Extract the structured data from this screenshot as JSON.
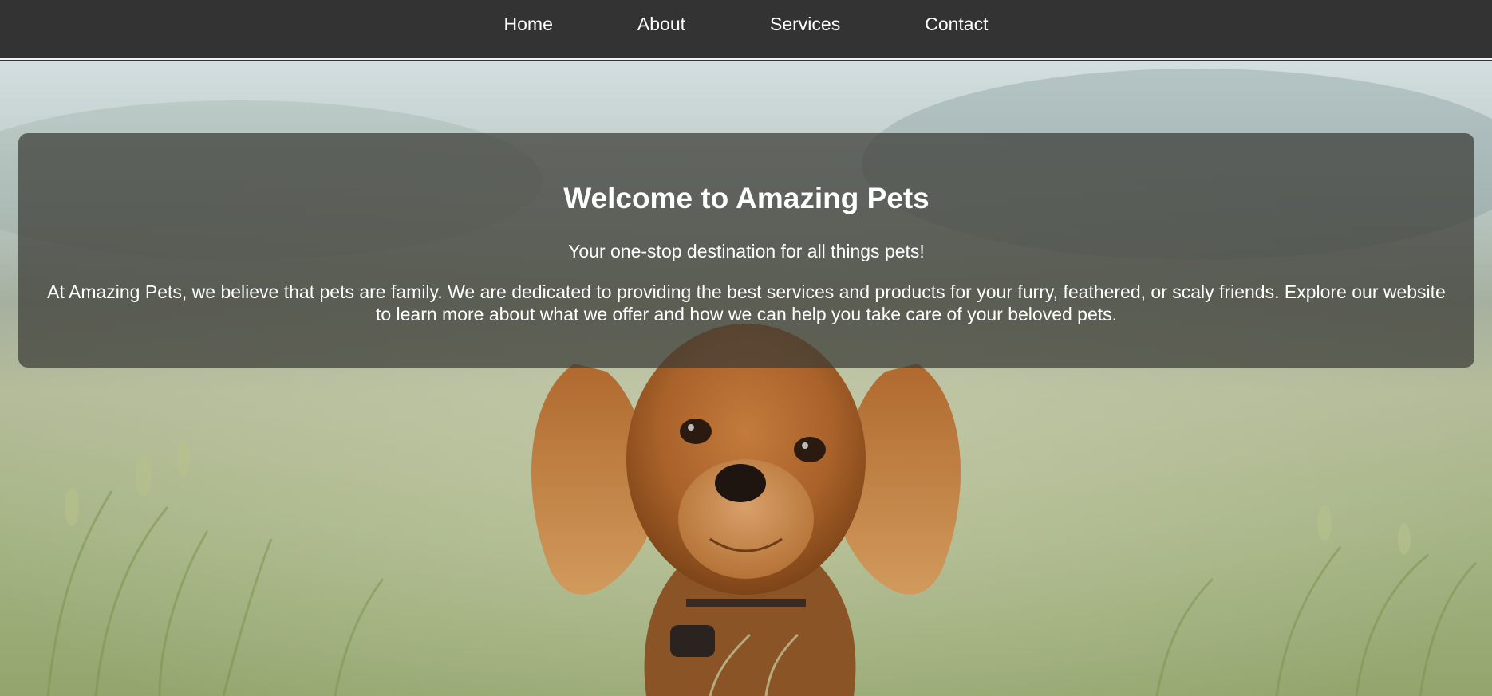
{
  "nav": {
    "items": [
      {
        "label": "Home"
      },
      {
        "label": "About"
      },
      {
        "label": "Services"
      },
      {
        "label": "Contact"
      }
    ]
  },
  "hero": {
    "image": "dog-in-grass-photo",
    "title": "Welcome to Amazing Pets",
    "tagline": "Your one-stop destination for all things pets!",
    "body": "At Amazing Pets, we believe that pets are family. We are dedicated to providing the best services and products for your furry, feathered, or scaly friends. Explore our website to learn more about what we offer and how we can help you take care of your beloved pets."
  },
  "colors": {
    "nav_background": "#333333",
    "nav_text": "#ffffff",
    "overlay": "rgba(58,58,52,0.72)"
  }
}
